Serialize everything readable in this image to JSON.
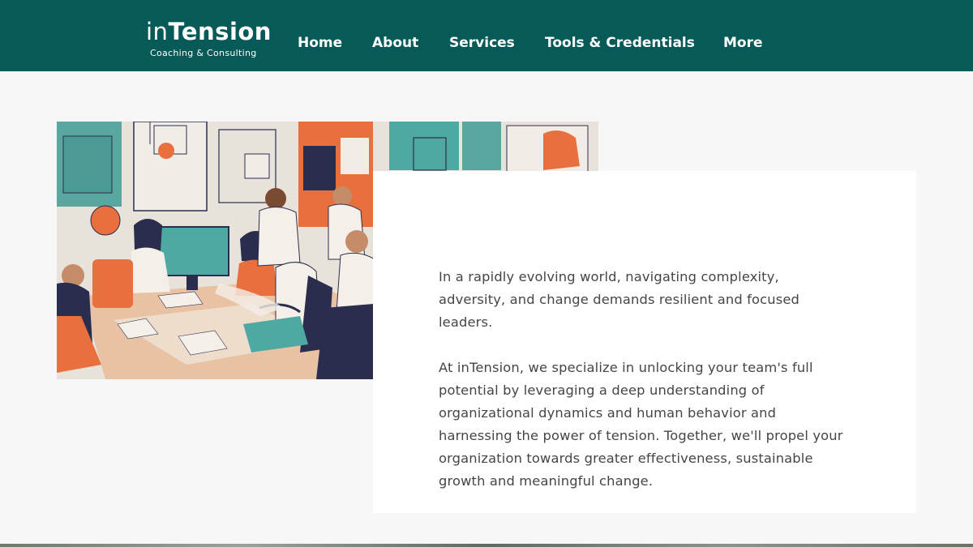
{
  "header": {
    "logo": {
      "name_part1": "in",
      "name_part2": "Tension",
      "tagline": "Coaching & Consulting"
    },
    "nav": [
      {
        "label": "Home"
      },
      {
        "label": "About"
      },
      {
        "label": "Services"
      },
      {
        "label": "Tools & Credentials"
      },
      {
        "label": "More"
      }
    ],
    "bg_color": "#075a58"
  },
  "hero": {
    "image_subject": "illustration of a team collaborating around office desks"
  },
  "card": {
    "paragraphs": [
      "In a rapidly evolving world, navigating complexity, adversity, and change demands resilient and focused leaders.",
      "At inTension, we specialize in unlocking your team's full potential by leveraging a deep understanding of organizational dynamics and human behavior and harnessing the power of tension. Together, we'll propel your organization towards greater effectiveness, sustainable growth and meaningful change."
    ]
  },
  "colors": {
    "teal": "#075a58",
    "accent_orange": "#e8703f",
    "accent_teal": "#4fa9a3",
    "navy": "#2b2d4e",
    "text": "#454545"
  }
}
